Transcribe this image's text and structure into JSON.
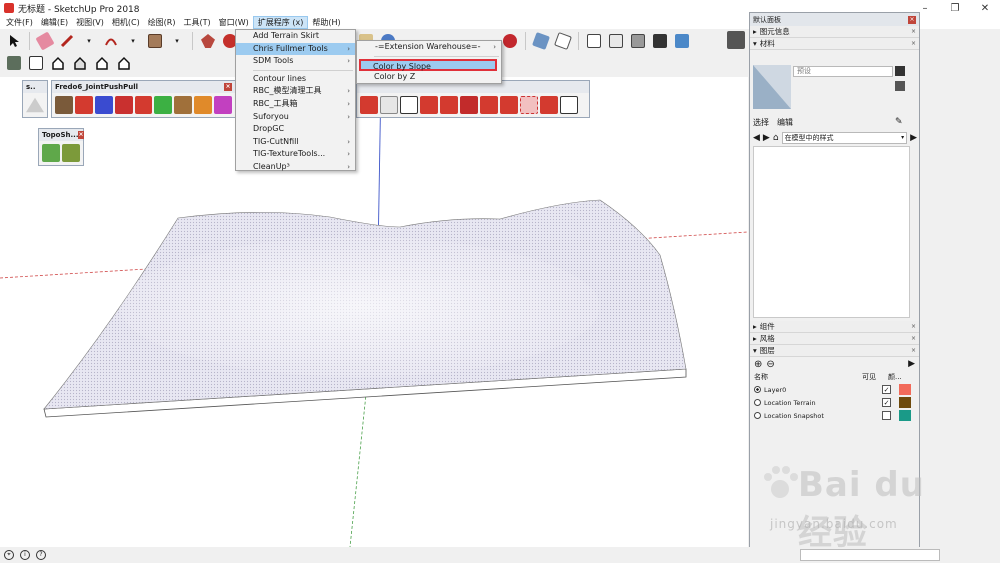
{
  "window": {
    "title": "无标题 - SketchUp Pro 2018"
  },
  "menubar": {
    "items": [
      "文件(F)",
      "编辑(E)",
      "视图(V)",
      "相机(C)",
      "绘图(R)",
      "工具(T)",
      "窗口(W)",
      "扩展程序 (x)",
      "帮助(H)"
    ]
  },
  "extensions_menu": {
    "items": [
      {
        "label": "Add Terrain Skirt",
        "submenu": false
      },
      {
        "label": "Chris Fullmer Tools",
        "submenu": true
      },
      {
        "label": "SDM Tools",
        "submenu": true
      },
      {
        "label": "Contour lines",
        "submenu": false
      },
      {
        "label": "RBC_模型清理工具",
        "submenu": true
      },
      {
        "label": "RBC_工具箱",
        "submenu": true
      },
      {
        "label": "Suforyou",
        "submenu": true
      },
      {
        "label": "DropGC",
        "submenu": false
      },
      {
        "label": "TIG-CutNfill",
        "submenu": true
      },
      {
        "label": "TIG-TextureTools...",
        "submenu": true
      },
      {
        "label": "CleanUp³",
        "submenu": true
      }
    ]
  },
  "cf_submenu": {
    "items": [
      {
        "label": "-=Extension Warehouse=-",
        "submenu": true
      },
      {
        "label": "Color by Slope",
        "submenu": false
      },
      {
        "label": "Color by Z",
        "submenu": false
      }
    ]
  },
  "floating_toolbars": {
    "small_title": "s..",
    "fredo_title": "Fredo6_JointPushPull",
    "topo_title": "TopoSh..."
  },
  "tray": {
    "title": "默认面板",
    "sections": {
      "entity_info": "图元信息",
      "materials": "材料",
      "components": "组件",
      "styles": "风格",
      "layers": "图层"
    },
    "material_name": "预设",
    "tabs": {
      "select": "选择",
      "edit": "编辑"
    },
    "style_dropdown": "在模型中的样式",
    "layers": {
      "col_name": "名称",
      "col_visible": "可见",
      "col_color": "颜...",
      "rows": [
        {
          "name": "Layer0",
          "active": true,
          "visible": true,
          "color": "#f26a5a"
        },
        {
          "name": "Location Terrain",
          "active": false,
          "visible": true,
          "color": "#6e4a0c"
        },
        {
          "name": "Location Snapshot",
          "active": false,
          "visible": false,
          "color": "#1a9a88"
        }
      ]
    }
  },
  "watermark": {
    "text": "Bai du 经验",
    "sub": "jingyan.baidu.com"
  },
  "colors": {
    "terrain": "#e2e1ee",
    "axis_red": "#d04848",
    "axis_green": "#4aa04a",
    "axis_blue": "#3d55c9",
    "highlight": "#9ccbf0"
  }
}
